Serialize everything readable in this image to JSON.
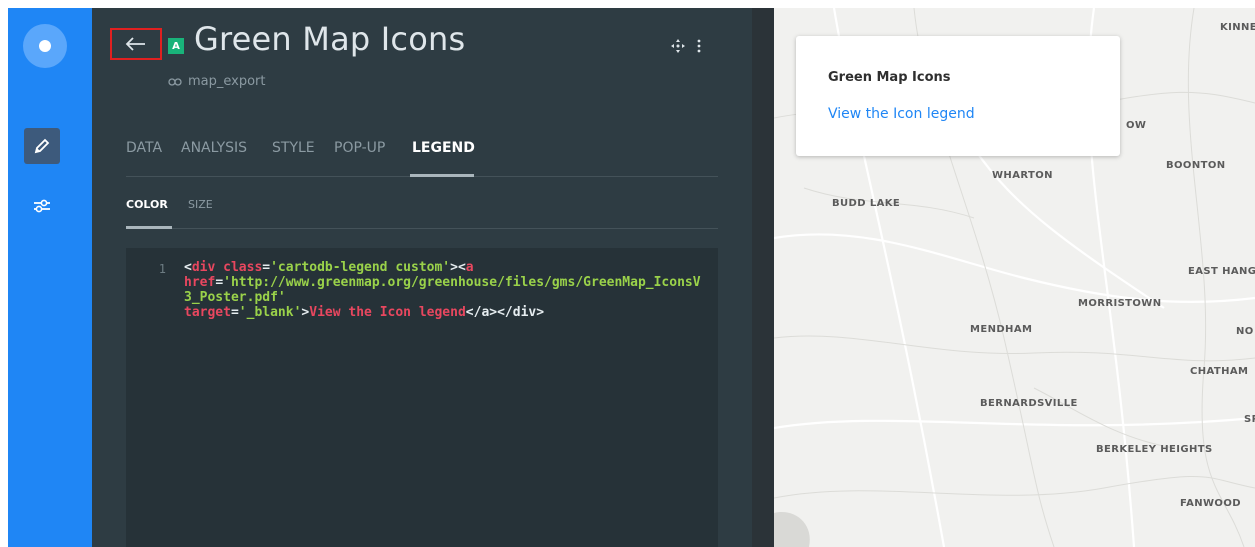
{
  "app": {
    "accent_color": "#1f86f5",
    "panel_color": "#2e3c43"
  },
  "rail": {
    "items": [
      {
        "name": "edit",
        "icon": "pencil-icon"
      },
      {
        "name": "filters",
        "icon": "sliders-icon"
      }
    ]
  },
  "header": {
    "back_icon": "arrow-left-icon",
    "layer_letter": "A",
    "title": "Green Map Icons",
    "subtitle": "map_export"
  },
  "tabs": [
    {
      "label": "DATA",
      "active": false
    },
    {
      "label": "ANALYSIS",
      "active": false
    },
    {
      "label": "STYLE",
      "active": false
    },
    {
      "label": "POP-UP",
      "active": false
    },
    {
      "label": "LEGEND",
      "active": true
    }
  ],
  "subtabs": [
    {
      "label": "COLOR",
      "active": true
    },
    {
      "label": "SIZE",
      "active": false
    }
  ],
  "editor": {
    "line_number": "1",
    "tag_open": "<",
    "tag_div": "div",
    "attr_class": " class",
    "eq": "=",
    "class_value": "'cartodb-legend custom'",
    "gt_lt": "><",
    "tag_a": "a",
    "attr_href": "href",
    "href_value": "'http://www.greenmap.org/greenhouse/files/gms/GreenMap_IconsV3_Poster.pdf'",
    "attr_target": "target",
    "target_value": "'_blank'",
    "link_text": "View the Icon legend",
    "close_tags": "</a></div>"
  },
  "map": {
    "legend": {
      "title": "Green Map Icons",
      "link_text": "View the Icon legend"
    },
    "places": [
      {
        "name": "KINNELO"
      },
      {
        "name": "OW"
      },
      {
        "name": "BOONTON"
      },
      {
        "name": "WHARTON"
      },
      {
        "name": "BUDD LAKE"
      },
      {
        "name": "EAST HANG"
      },
      {
        "name": "MORRISTOWN"
      },
      {
        "name": "MENDHAM"
      },
      {
        "name": "NO"
      },
      {
        "name": "CHATHAM"
      },
      {
        "name": "BERNARDSVILLE"
      },
      {
        "name": "SP"
      },
      {
        "name": "BERKELEY HEIGHTS"
      },
      {
        "name": "FANWOOD"
      }
    ]
  }
}
